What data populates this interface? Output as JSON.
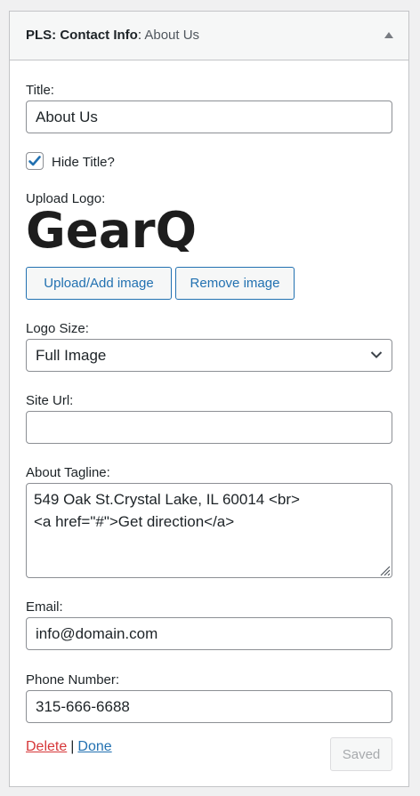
{
  "widget": {
    "name": "PLS: Contact Info",
    "separator": ": ",
    "instance_title": "About Us"
  },
  "form": {
    "title_label": "Title:",
    "title_value": "About Us",
    "hide_title_label": "Hide Title?",
    "hide_title_checked": true,
    "upload_logo_label": "Upload Logo:",
    "logo_text": "GearQ",
    "upload_button": "Upload/Add image",
    "remove_button": "Remove image",
    "logo_size_label": "Logo Size:",
    "logo_size_value": "Full Image",
    "site_url_label": "Site Url:",
    "site_url_value": "",
    "about_tagline_label": "About Tagline:",
    "about_tagline_lines": [
      "549 Oak St.Crystal Lake, IL 60014 <br>",
      "<a href=\"#\">Get direction</a>"
    ],
    "email_label": "Email:",
    "email_value": "info@domain.com",
    "phone_label": "Phone Number:",
    "phone_value": "315-666-6688"
  },
  "actions": {
    "delete_label": "Delete",
    "pipe": "|",
    "done_label": "Done",
    "saved_label": "Saved"
  },
  "colors": {
    "link_blue": "#2271b1",
    "delete_red": "#d63638",
    "border_gray": "#8c8f94"
  }
}
